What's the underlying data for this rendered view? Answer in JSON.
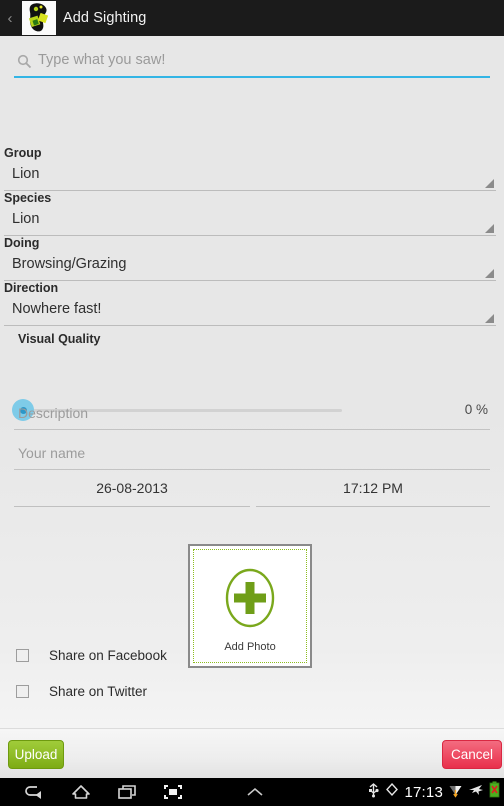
{
  "titlebar": {
    "back_label": "‹",
    "title": "Add Sighting",
    "icon_name": "africa-wildlife-app-icon"
  },
  "search": {
    "placeholder": "Type what you saw!",
    "value": "",
    "icon": "search-icon",
    "underline_color": "#33b5e5"
  },
  "form": {
    "fields": [
      {
        "label": "Group",
        "value": "Lion"
      },
      {
        "label": "Species",
        "value": "Lion"
      },
      {
        "label": "Doing",
        "value": "Browsing/Grazing"
      },
      {
        "label": "Direction",
        "value": "Nowhere fast!"
      }
    ],
    "visual_quality": {
      "label": "Visual Quality",
      "value_text": "0 %",
      "percent": 0,
      "thumb_color": "#7ecbe8"
    },
    "description": {
      "placeholder": "Description",
      "value": ""
    },
    "your_name": {
      "placeholder": "Your name",
      "value": ""
    },
    "date": "26-08-2013",
    "time": "17:12 PM",
    "photo": {
      "label": "Add Photo",
      "icon": "plus-in-ellipse-icon",
      "accent": "#8dbd1f"
    },
    "checkboxes": [
      {
        "label": "Share on Facebook",
        "checked": false
      },
      {
        "label": "Share on Twitter",
        "checked": false
      }
    ]
  },
  "buttons": {
    "upload": "Upload",
    "cancel": "Cancel",
    "upload_color": "#8ebb26",
    "cancel_color": "#ee4a62"
  },
  "navbar": {
    "back_icon": "back-arrow-icon",
    "home_icon": "home-icon",
    "recents_icon": "recent-apps-icon",
    "screenshot_icon": "screenshot-icon",
    "expand_icon": "chevron-up-icon",
    "usb_icon": "usb-icon",
    "gps_icon": "gps-diamond-icon",
    "clock": "17:13",
    "wifi_icon": "wifi-icon",
    "airplane_icon": "airplane-mode-icon",
    "battery_icon": "battery-error-icon"
  }
}
